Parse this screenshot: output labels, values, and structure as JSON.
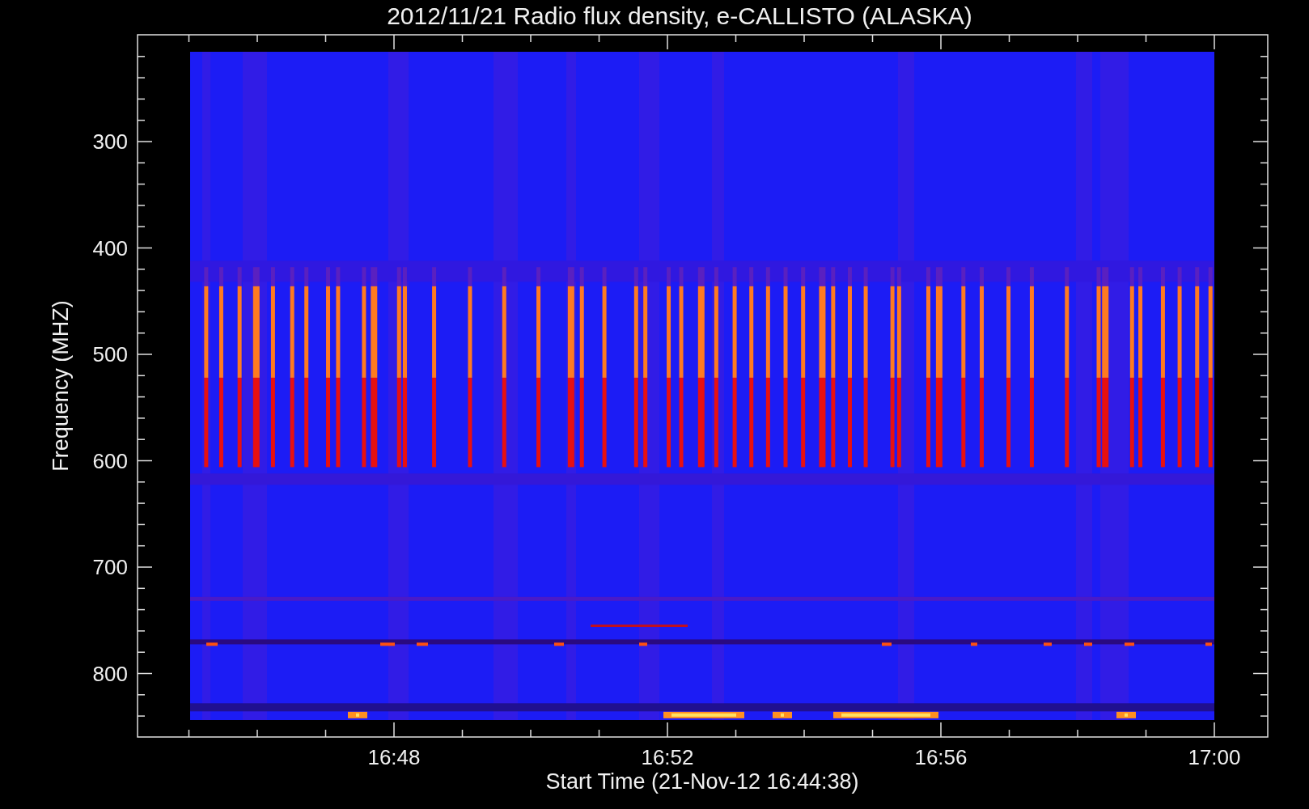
{
  "title": "2012/11/21  Radio flux density, e-CALLISTO (ALASKA)",
  "y_axis": {
    "label": "Frequency (MHZ)",
    "ticks": [
      "300",
      "400",
      "500",
      "600",
      "700",
      "800"
    ]
  },
  "x_axis": {
    "label": "Start Time (21-Nov-12 16:44:38)",
    "ticks": [
      "16:48",
      "16:52",
      "16:56",
      "17:00"
    ]
  }
}
